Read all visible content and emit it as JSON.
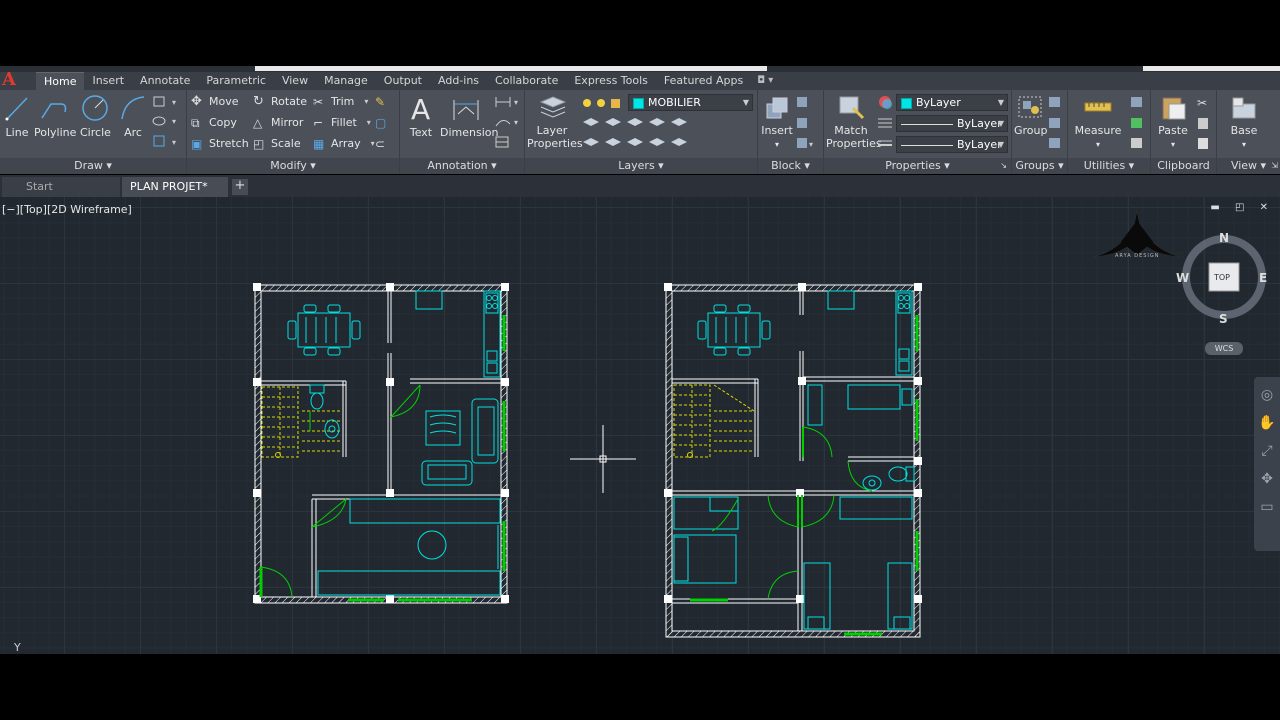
{
  "ribbon_tabs": [
    "Home",
    "Insert",
    "Annotate",
    "Parametric",
    "View",
    "Manage",
    "Output",
    "Add-ins",
    "Collaborate",
    "Express Tools",
    "Featured Apps"
  ],
  "active_tab": "Home",
  "draw": {
    "line": "Line",
    "polyline": "Polyline",
    "circle": "Circle",
    "arc": "Arc",
    "title": "Draw ▾"
  },
  "modify": {
    "move": "Move",
    "rotate": "Rotate",
    "trim": "Trim",
    "copy": "Copy",
    "mirror": "Mirror",
    "fillet": "Fillet",
    "stretch": "Stretch",
    "scale": "Scale",
    "array": "Array",
    "title": "Modify ▾"
  },
  "annotation": {
    "text": "Text",
    "dimension": "Dimension",
    "title": "Annotation ▾"
  },
  "layers": {
    "layer_properties_1": "Layer",
    "layer_properties_2": "Properties",
    "current_layer": "MOBILIER",
    "title": "Layers ▾"
  },
  "block": {
    "insert": "Insert",
    "title": "Block ▾"
  },
  "properties": {
    "match_1": "Match",
    "match_2": "Properties",
    "color": "ByLayer",
    "linetype": "ByLayer",
    "lineweight": "ByLayer",
    "title": "Properties ▾"
  },
  "groups": {
    "group": "Group",
    "title": "Groups ▾"
  },
  "utilities": {
    "measure": "Measure",
    "title": "Utilities ▾"
  },
  "clipboard": {
    "paste": "Paste",
    "title": "Clipboard"
  },
  "view_panel": {
    "base": "Base",
    "title": "View ▾"
  },
  "file_tabs": {
    "start": "Start",
    "plan": "PLAN PROJET*",
    "add": "+"
  },
  "viewport": {
    "label": "[−][Top][2D Wireframe]",
    "ucs_y": "Y",
    "wcs": "WCS"
  },
  "viewcube": {
    "n": "N",
    "s": "S",
    "e": "E",
    "w": "W",
    "top": "TOP"
  },
  "watermark": "ARYA DESIGN",
  "colors": {
    "cyan": "#00e0e0",
    "yellow": "#d8d800",
    "green": "#00d000",
    "white": "#ffffff"
  }
}
